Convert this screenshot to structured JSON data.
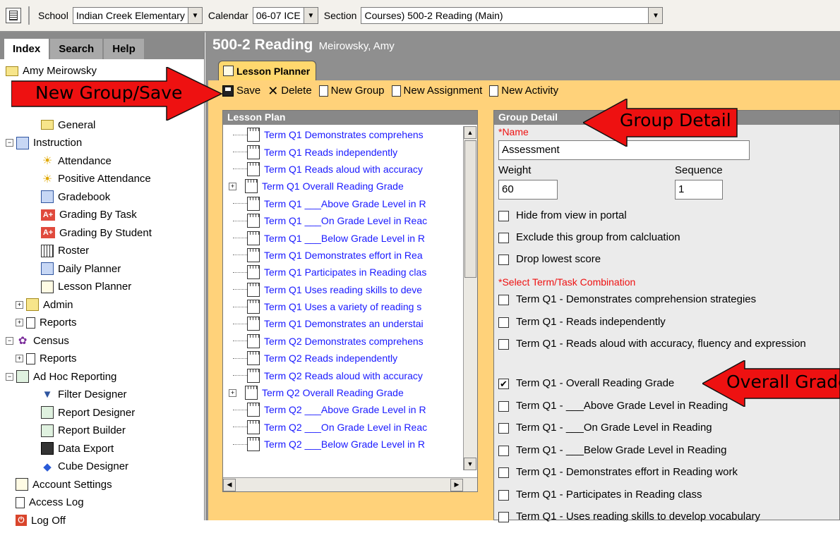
{
  "topbar": {
    "school_label": "School",
    "school_value": "Indian Creek Elementary",
    "calendar_label": "Calendar",
    "calendar_value": "06-07 ICE",
    "section_label": "Section",
    "section_value": "Courses) 500-2 Reading (Main)"
  },
  "nav": {
    "tabs": [
      "Index",
      "Search",
      "Help"
    ],
    "tree": [
      {
        "label": "Amy Meirowsky",
        "icon": "teacher-icon",
        "indent": 0
      },
      {
        "label": "General",
        "icon": "folder-icon",
        "indent": 3
      },
      {
        "label": "Instruction",
        "icon": "instruction-icon",
        "indent": 0,
        "expander": "−"
      },
      {
        "label": "Attendance",
        "icon": "attendance-icon",
        "indent": 2
      },
      {
        "label": "Positive Attendance",
        "icon": "positive-attendance-icon",
        "indent": 2
      },
      {
        "label": "Gradebook",
        "icon": "gradebook-icon",
        "indent": 2
      },
      {
        "label": "Grading By Task",
        "icon": "grading-by-task-icon",
        "indent": 2
      },
      {
        "label": "Grading By Student",
        "icon": "grading-by-student-icon",
        "indent": 2
      },
      {
        "label": "Roster",
        "icon": "roster-icon",
        "indent": 2
      },
      {
        "label": "Daily Planner",
        "icon": "daily-planner-icon",
        "indent": 2
      },
      {
        "label": "Lesson Planner",
        "icon": "lesson-planner-icon",
        "indent": 2
      },
      {
        "label": "Admin",
        "icon": "admin-icon",
        "indent": 1,
        "expander": "+"
      },
      {
        "label": "Reports",
        "icon": "reports-icon",
        "indent": 1,
        "expander": "+"
      },
      {
        "label": "Census",
        "icon": "census-icon",
        "indent": 0,
        "expander": "−"
      },
      {
        "label": "Reports",
        "icon": "reports-icon",
        "indent": 1,
        "expander": "+"
      },
      {
        "label": "Ad Hoc Reporting",
        "icon": "ad-hoc-icon",
        "indent": 0,
        "expander": "−"
      },
      {
        "label": "Filter Designer",
        "icon": "filter-icon",
        "indent": 2
      },
      {
        "label": "Report Designer",
        "icon": "report-designer-icon",
        "indent": 2
      },
      {
        "label": "Report Builder",
        "icon": "report-builder-icon",
        "indent": 2
      },
      {
        "label": "Data Export",
        "icon": "data-export-icon",
        "indent": 2
      },
      {
        "label": "Cube Designer",
        "icon": "cube-icon",
        "indent": 2
      },
      {
        "label": "Account Settings",
        "icon": "account-settings-icon",
        "indent": 1
      },
      {
        "label": "Access Log",
        "icon": "access-log-icon",
        "indent": 1
      },
      {
        "label": "Log Off",
        "icon": "log-off-icon",
        "indent": 1
      }
    ]
  },
  "main": {
    "title": "500-2 Reading",
    "teacher": "Meirowsky, Amy",
    "tab_label": "Lesson Planner",
    "toolbar": {
      "save": "Save",
      "delete": "Delete",
      "new_group": "New Group",
      "new_assignment": "New Assignment",
      "new_activity": "New Activity"
    },
    "lesson_plan": {
      "header": "Lesson Plan",
      "items": [
        {
          "label": "Term Q1 Demonstrates comprehens",
          "expander": ""
        },
        {
          "label": "Term Q1 Reads independently",
          "expander": ""
        },
        {
          "label": "Term Q1 Reads aloud with accuracy",
          "expander": ""
        },
        {
          "label": "Term Q1 Overall Reading Grade",
          "expander": "+"
        },
        {
          "label": "Term Q1 ___Above Grade Level in R",
          "expander": ""
        },
        {
          "label": "Term Q1 ___On Grade Level in Reac",
          "expander": ""
        },
        {
          "label": "Term Q1 ___Below Grade Level in R",
          "expander": ""
        },
        {
          "label": "Term Q1 Demonstrates effort in Rea",
          "expander": ""
        },
        {
          "label": "Term Q1 Participates in Reading clas",
          "expander": ""
        },
        {
          "label": "Term Q1 Uses reading skills to deve",
          "expander": ""
        },
        {
          "label": "Term Q1 Uses a variety of reading s",
          "expander": ""
        },
        {
          "label": "Term Q1 Demonstrates an understai",
          "expander": ""
        },
        {
          "label": "Term Q2 Demonstrates comprehens",
          "expander": ""
        },
        {
          "label": "Term Q2 Reads independently",
          "expander": ""
        },
        {
          "label": "Term Q2 Reads aloud with accuracy",
          "expander": ""
        },
        {
          "label": "Term Q2 Overall Reading Grade",
          "expander": "+"
        },
        {
          "label": "Term Q2 ___Above Grade Level in R",
          "expander": ""
        },
        {
          "label": "Term Q2 ___On Grade Level in Reac",
          "expander": ""
        },
        {
          "label": "Term Q2 ___Below Grade Level in R",
          "expander": ""
        }
      ]
    },
    "group_detail": {
      "header": "Group Detail",
      "name_label": "*Name",
      "name_value": "Assessment",
      "weight_label": "Weight",
      "weight_value": "60",
      "sequence_label": "Sequence",
      "sequence_value": "1",
      "options": [
        {
          "label": "Hide from view in portal",
          "checked": false
        },
        {
          "label": "Exclude this group from calcluation",
          "checked": false
        },
        {
          "label": "Drop lowest score",
          "checked": false
        }
      ],
      "combination_label": "*Select Term/Task Combination",
      "combinations": [
        {
          "label": "Term Q1 - Demonstrates comprehension strategies",
          "checked": false
        },
        {
          "label": "Term Q1 - Reads independently",
          "checked": false
        },
        {
          "label": "Term Q1 - Reads aloud with accuracy, fluency and expression",
          "checked": false
        },
        {
          "label": "Term Q1 - Overall Reading Grade",
          "checked": true
        },
        {
          "label": "Term Q1 - ___Above Grade Level in Reading",
          "checked": false
        },
        {
          "label": "Term Q1 - ___On Grade Level in Reading",
          "checked": false
        },
        {
          "label": "Term Q1 - ___Below Grade Level in Reading",
          "checked": false
        },
        {
          "label": "Term Q1 - Demonstrates effort in Reading work",
          "checked": false
        },
        {
          "label": "Term Q1 - Participates in Reading class",
          "checked": false
        },
        {
          "label": "Term Q1 - Uses reading skills to develop vocabulary",
          "checked": false
        }
      ]
    }
  },
  "annotations": {
    "new_group_save": "New Group/Save",
    "group_detail": "Group Detail",
    "overall_grade": "Overall Grade"
  },
  "colors": {
    "accent_orange": "#ffd27a",
    "tab_yellow": "#ffd86e",
    "arrow_red": "#ee1111",
    "link_blue": "#1a1aff",
    "chrome_gray": "#8f8f8f"
  }
}
